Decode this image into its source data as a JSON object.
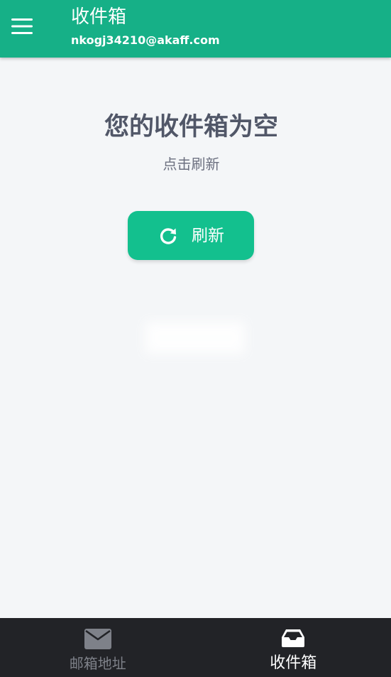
{
  "app_bar": {
    "title": "收件箱",
    "subtitle": "nkogj34210@akaff.com",
    "menu_icon": "hamburger-menu-icon"
  },
  "main": {
    "empty_title": "您的收件箱为空",
    "empty_hint": "点击刷新",
    "refresh_button": {
      "label": "刷新",
      "icon": "refresh-icon"
    }
  },
  "bottom_nav": {
    "items": [
      {
        "label": "邮箱地址",
        "icon": "envelope-icon",
        "active": false
      },
      {
        "label": "收件箱",
        "icon": "inbox-tray-icon",
        "active": true
      }
    ]
  },
  "colors": {
    "primary": "#16b087",
    "button": "#13c08e",
    "background": "#f4f6f8",
    "nav_background": "#222327",
    "heading_text": "#515768",
    "nav_inactive": "#7e8189",
    "nav_active": "#ffffff"
  }
}
